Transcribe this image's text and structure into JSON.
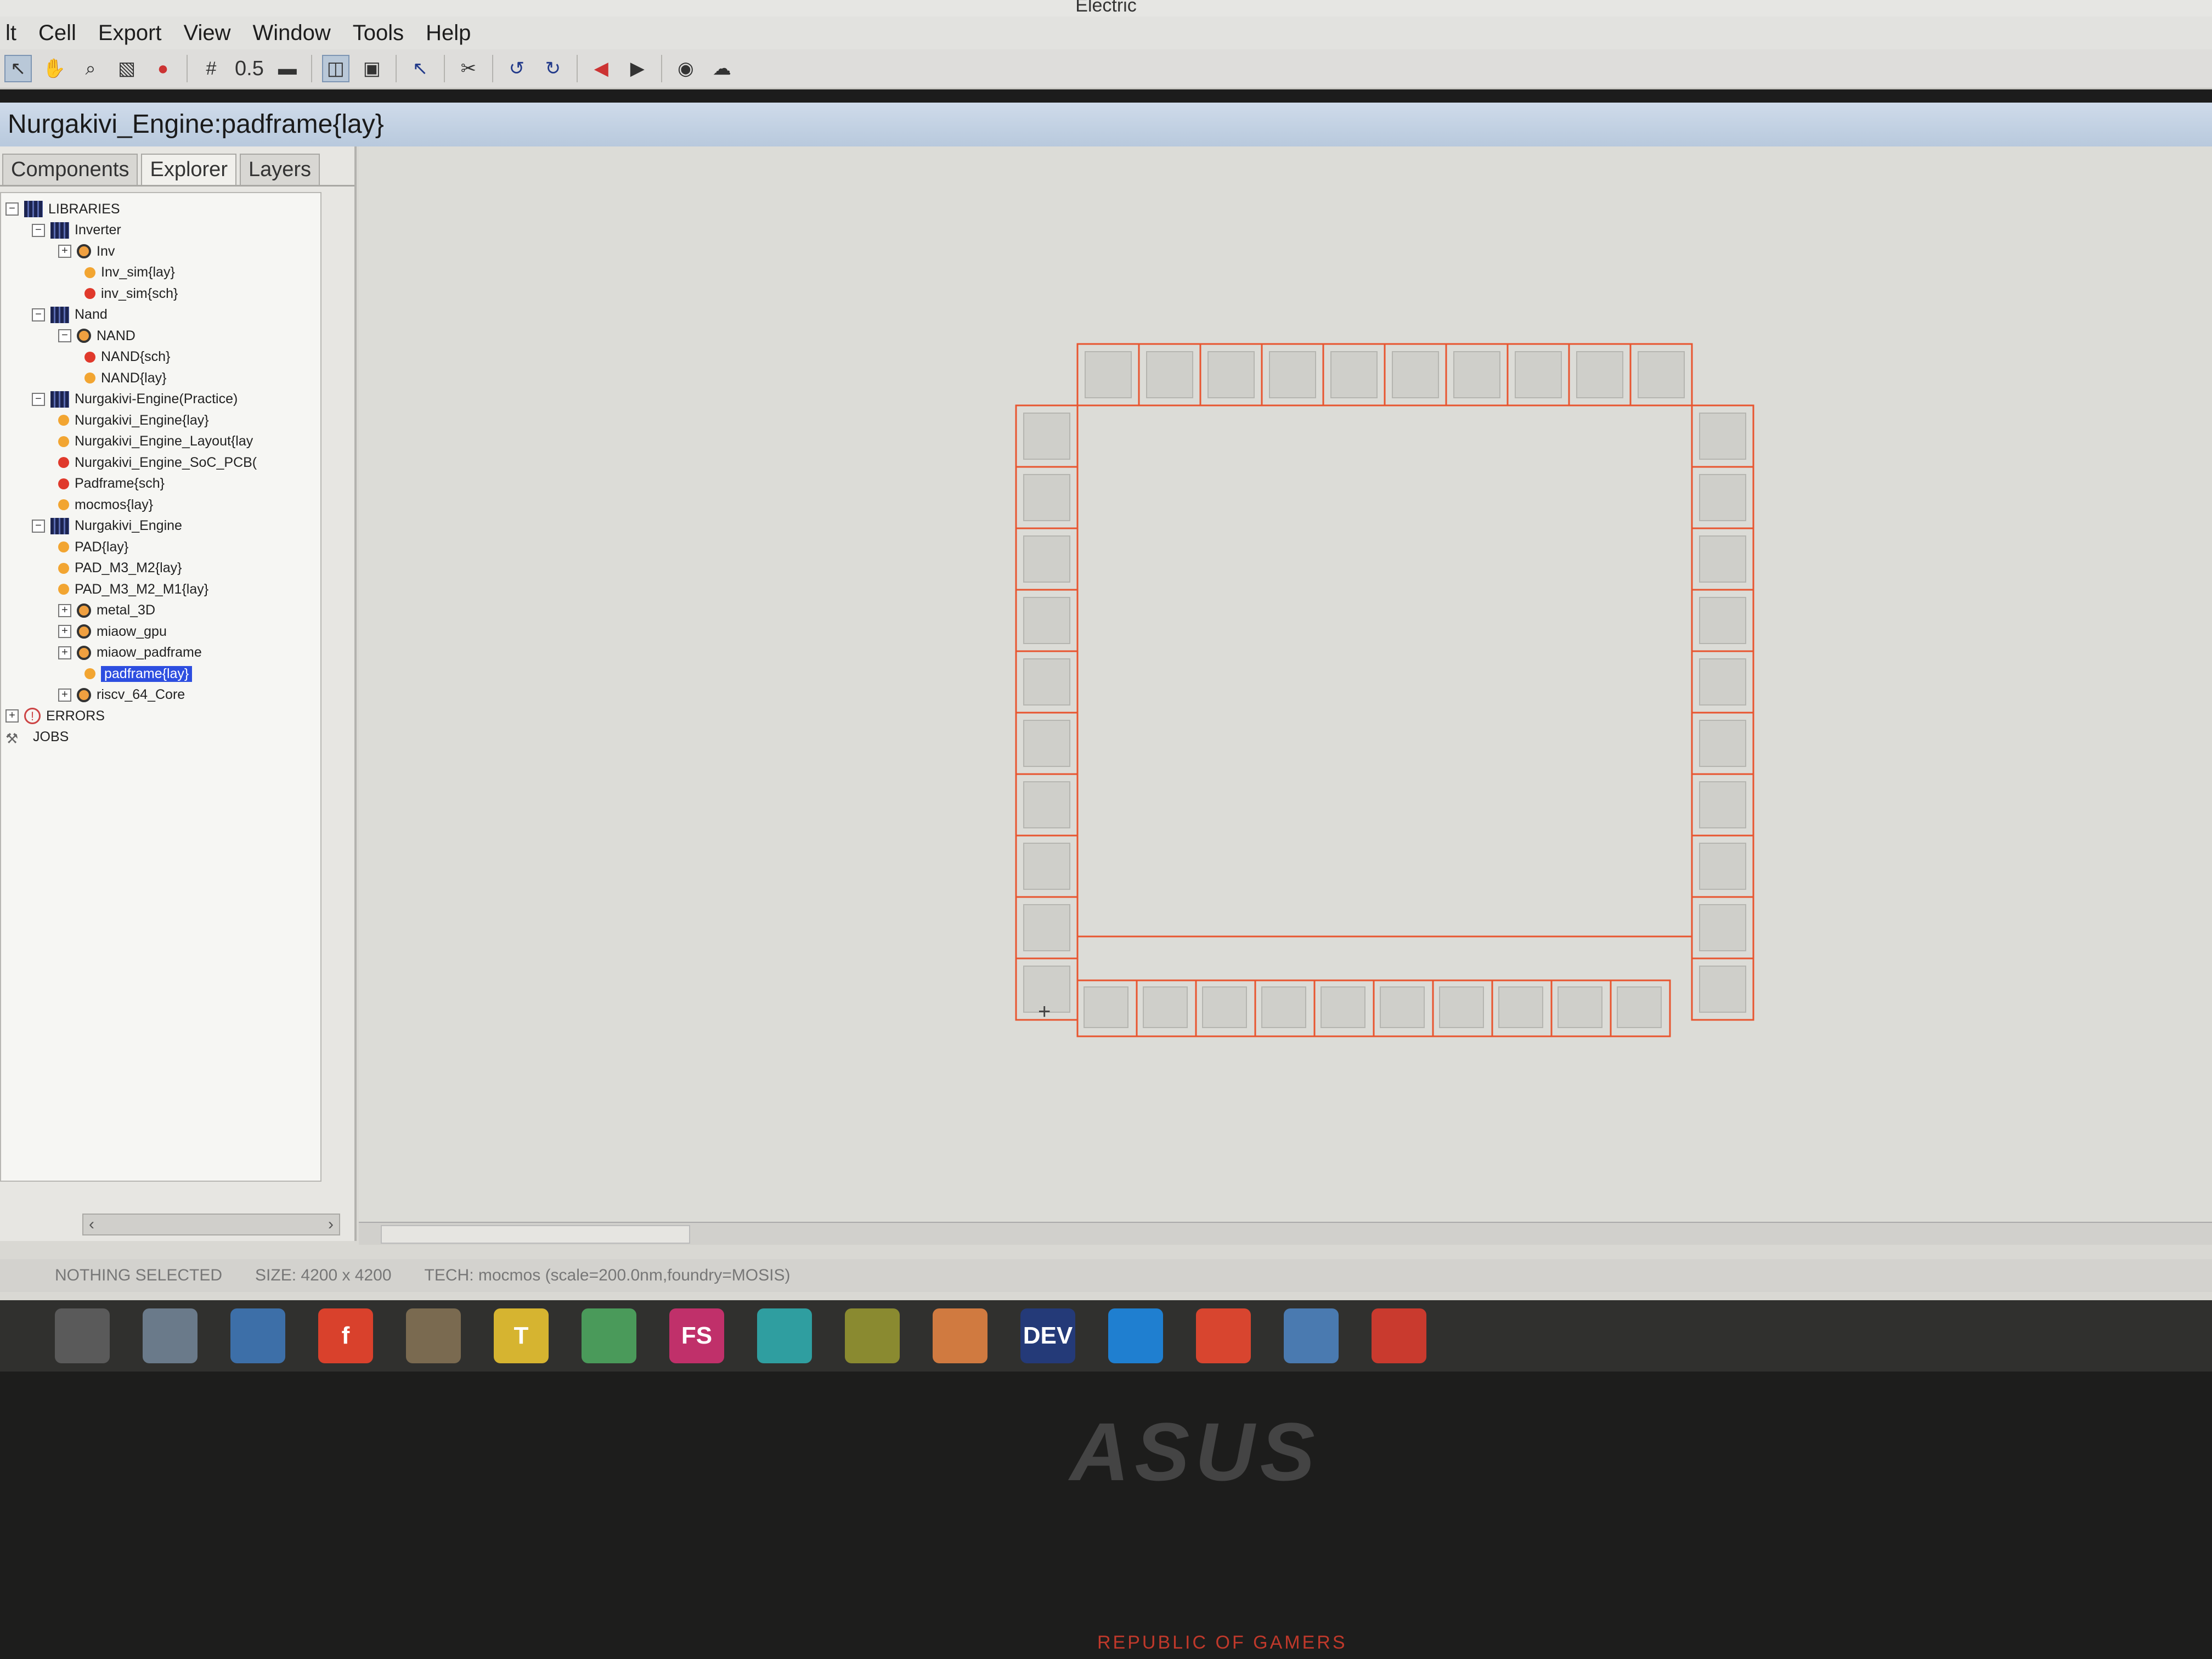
{
  "app": {
    "title": "Electric"
  },
  "menu": [
    "lt",
    "Cell",
    "Export",
    "View",
    "Window",
    "Tools",
    "Help"
  ],
  "toolbar": {
    "grid_value": "0.5",
    "icons": [
      "select-arrow-icon",
      "pan-hand-icon",
      "zoom-icon",
      "zoom-area-icon",
      "dot-icon",
      "grid-icon",
      "layer-icon",
      "wire-icon",
      "cell-icon",
      "cursor-icon",
      "cut-icon",
      "undo-icon",
      "redo-icon",
      "back-icon",
      "forward-icon",
      "eye-icon",
      "cloud-icon"
    ]
  },
  "window": {
    "title": "Nurgakivi_Engine:padframe{lay}"
  },
  "sidebar": {
    "tabs": [
      "Components",
      "Explorer",
      "Layers"
    ],
    "selected_tab": "Explorer",
    "tree": [
      {
        "label": "LIBRARIES",
        "type": "lib",
        "depth": 0,
        "expander": "-"
      },
      {
        "label": "Inverter",
        "type": "lib",
        "depth": 1,
        "expander": "-"
      },
      {
        "label": "Inv",
        "type": "cell",
        "depth": 2,
        "expander": "+"
      },
      {
        "label": "Inv_sim{lay}",
        "type": "orange",
        "depth": 3
      },
      {
        "label": "inv_sim{sch}",
        "type": "red",
        "depth": 3
      },
      {
        "label": "Nand",
        "type": "lib",
        "depth": 1,
        "expander": "-"
      },
      {
        "label": "NAND",
        "type": "cell",
        "depth": 2,
        "expander": "-"
      },
      {
        "label": "NAND{sch}",
        "type": "red",
        "depth": 3
      },
      {
        "label": "NAND{lay}",
        "type": "orange",
        "depth": 3
      },
      {
        "label": "Nurgakivi-Engine(Practice)",
        "type": "lib",
        "depth": 1,
        "expander": "-"
      },
      {
        "label": "Nurgakivi_Engine{lay}",
        "type": "orange",
        "depth": 2
      },
      {
        "label": "Nurgakivi_Engine_Layout{lay",
        "type": "orange",
        "depth": 2
      },
      {
        "label": "Nurgakivi_Engine_SoC_PCB(",
        "type": "red",
        "depth": 2
      },
      {
        "label": "Padframe{sch}",
        "type": "red",
        "depth": 2
      },
      {
        "label": "mocmos{lay}",
        "type": "orange",
        "depth": 2
      },
      {
        "label": "Nurgakivi_Engine",
        "type": "lib",
        "depth": 1,
        "expander": "-"
      },
      {
        "label": "PAD{lay}",
        "type": "orange",
        "depth": 2
      },
      {
        "label": "PAD_M3_M2{lay}",
        "type": "orange",
        "depth": 2
      },
      {
        "label": "PAD_M3_M2_M1{lay}",
        "type": "orange",
        "depth": 2
      },
      {
        "label": "metal_3D",
        "type": "cell",
        "depth": 2,
        "expander": "+"
      },
      {
        "label": "miaow_gpu",
        "type": "cell",
        "depth": 2,
        "expander": "+"
      },
      {
        "label": "miaow_padframe",
        "type": "cell",
        "depth": 2,
        "expander": "+"
      },
      {
        "label": "padframe{lay}",
        "type": "orange",
        "depth": 3,
        "selected": true
      },
      {
        "label": "riscv_64_Core",
        "type": "cell",
        "depth": 2,
        "expander": "+"
      },
      {
        "label": "ERRORS",
        "type": "error",
        "depth": 0,
        "expander": "+"
      },
      {
        "label": "JOBS",
        "type": "job",
        "depth": 0
      }
    ]
  },
  "padframe": {
    "top_pads": 10,
    "bottom_pads": 10,
    "left_pads": 10,
    "right_pads": 10,
    "outline_color": "#e8552f"
  },
  "status": {
    "selection": "NOTHING SELECTED",
    "size": "SIZE: 4200 x 4200",
    "tech": "TECH: mocmos (scale=200.0nm,foundry=MOSIS)"
  },
  "taskbar": {
    "apps": [
      {
        "name": "windows-start-icon",
        "label": "",
        "color": "#5a5a5a"
      },
      {
        "name": "electric-app-icon",
        "label": "",
        "color": "#6a7a8a"
      },
      {
        "name": "python-icon",
        "label": "",
        "color": "#3d6fa8"
      },
      {
        "name": "flash-icon",
        "label": "f",
        "color": "#d9412c"
      },
      {
        "name": "tools-icon",
        "label": "",
        "color": "#7a6a50"
      },
      {
        "name": "notes-icon",
        "label": "T",
        "color": "#d6b430"
      },
      {
        "name": "maps-icon",
        "label": "",
        "color": "#4a9a5a"
      },
      {
        "name": "fs-icon",
        "label": "FS",
        "color": "#c0306a"
      },
      {
        "name": "document-icon",
        "label": "",
        "color": "#2f9ea0"
      },
      {
        "name": "tiles-icon",
        "label": "",
        "color": "#8a8a30"
      },
      {
        "name": "color-wheel-icon",
        "label": "",
        "color": "#d07a40"
      },
      {
        "name": "dev-icon",
        "label": "DEV",
        "color": "#243a78"
      },
      {
        "name": "edge-icon",
        "label": "",
        "color": "#1f7fd0"
      },
      {
        "name": "chrome-icon",
        "label": "",
        "color": "#d8452f"
      },
      {
        "name": "photos-icon",
        "label": "",
        "color": "#4a7ab0"
      },
      {
        "name": "record-icon",
        "label": "",
        "color": "#c93a2e"
      }
    ]
  },
  "bezel": {
    "brand": "ASUS",
    "sub": "REPUBLIC OF GAMERS"
  }
}
